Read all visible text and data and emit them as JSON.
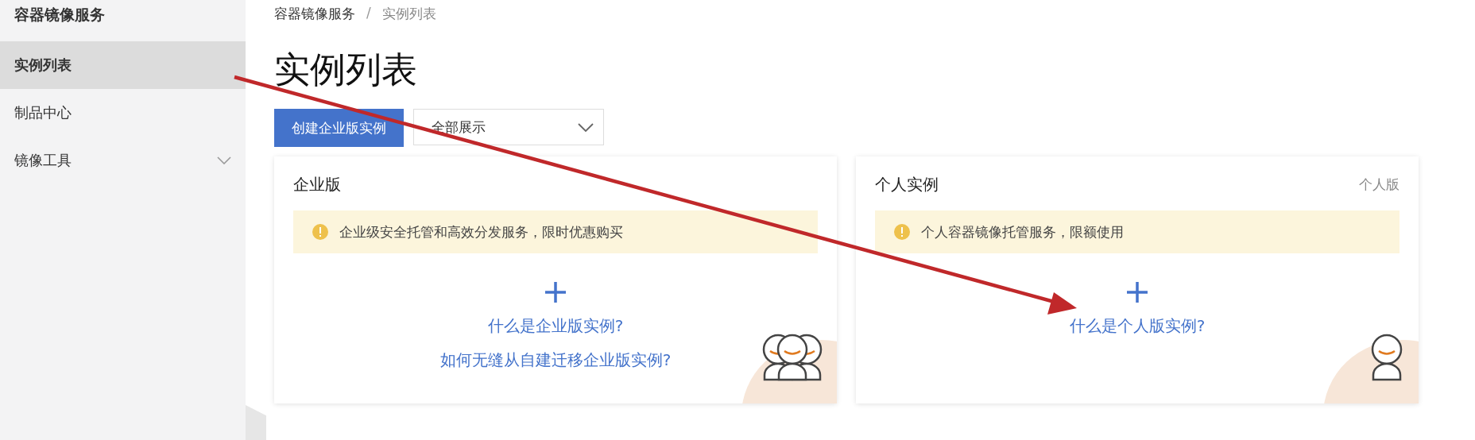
{
  "sidebar": {
    "title": "容器镜像服务",
    "items": [
      {
        "label": "实例列表",
        "selected": true,
        "kind": "link"
      },
      {
        "label": "制品中心",
        "selected": false,
        "kind": "link"
      },
      {
        "label": "镜像工具",
        "selected": false,
        "kind": "group"
      }
    ]
  },
  "breadcrumb": {
    "separator": "/",
    "items": [
      "容器镜像服务",
      "实例列表"
    ]
  },
  "page_title": "实例列表",
  "create_button": "创建企业版实例",
  "filter_select": {
    "value": "全部展示"
  },
  "cards": [
    {
      "title": "企业版",
      "notice": "企业级安全托管和高效分发服务，限时优惠购买",
      "links": [
        "什么是企业版实例?",
        "如何无缝从自建迁移企业版实例?"
      ],
      "kind": "group"
    },
    {
      "title": "个人实例",
      "tag": "个人版",
      "notice": "个人容器镜像托管服务，限额使用",
      "links": [
        "什么是个人版实例?"
      ],
      "kind": "single"
    }
  ]
}
